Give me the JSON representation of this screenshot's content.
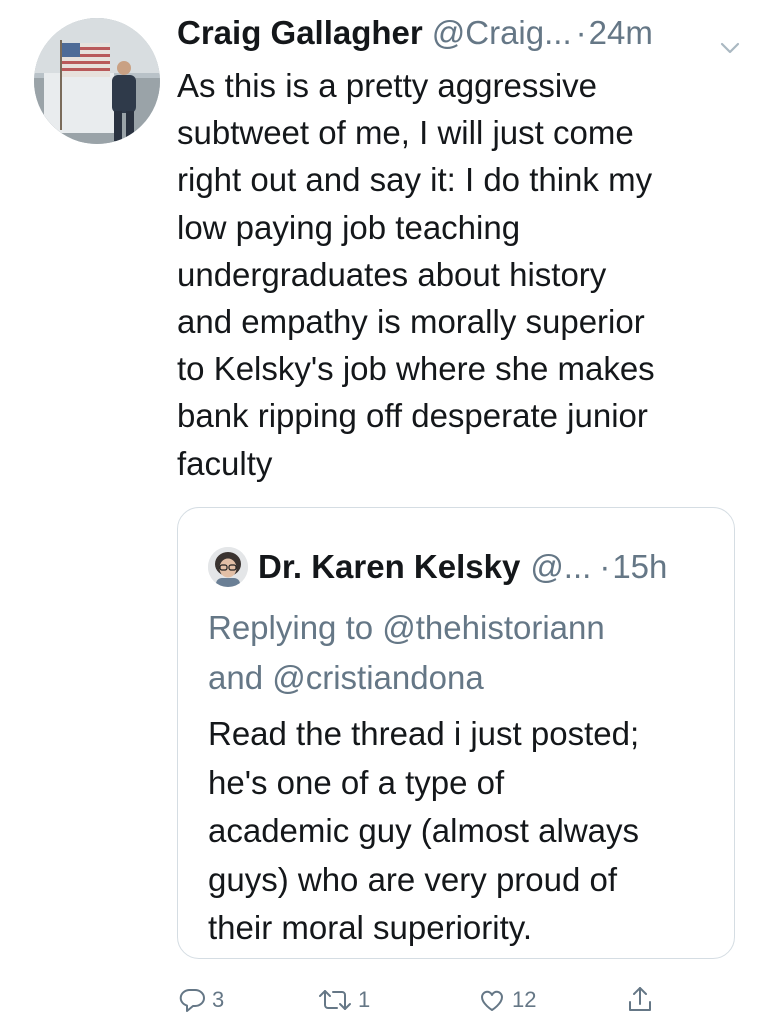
{
  "tweet": {
    "author_name": "Craig Gallagher",
    "author_handle": "@Craig...",
    "dot": "·",
    "time": "24m",
    "text_lines": [
      "As this is a pretty aggressive",
      "subtweet of me, I will just come",
      "right out and say it: I do think my",
      "low paying job teaching",
      "undergraduates about history",
      "and empathy is morally superior",
      "to Kelsky's job where she makes",
      "bank ripping off desperate junior",
      "faculty"
    ]
  },
  "quoted_tweet": {
    "author_name": "Dr. Karen Kelsky",
    "author_handle": "@...",
    "dot": "·",
    "time": "15h",
    "reply_lines": [
      "Replying to @thehistoriann",
      "and @cristiandona"
    ],
    "text_lines": [
      "Read the thread i just posted;",
      "he's one of a type of",
      "academic guy (almost always",
      "guys) who are very proud of",
      "their moral superiority."
    ]
  },
  "actions": {
    "reply_count": "3",
    "retweet_count": "1",
    "like_count": "12"
  },
  "icons": {
    "caret": "chevron-down-icon",
    "reply": "reply-icon",
    "retweet": "retweet-icon",
    "like": "heart-icon",
    "share": "share-icon"
  },
  "colors": {
    "text": "#14171a",
    "secondary": "#657786",
    "border": "#d5dde3"
  }
}
